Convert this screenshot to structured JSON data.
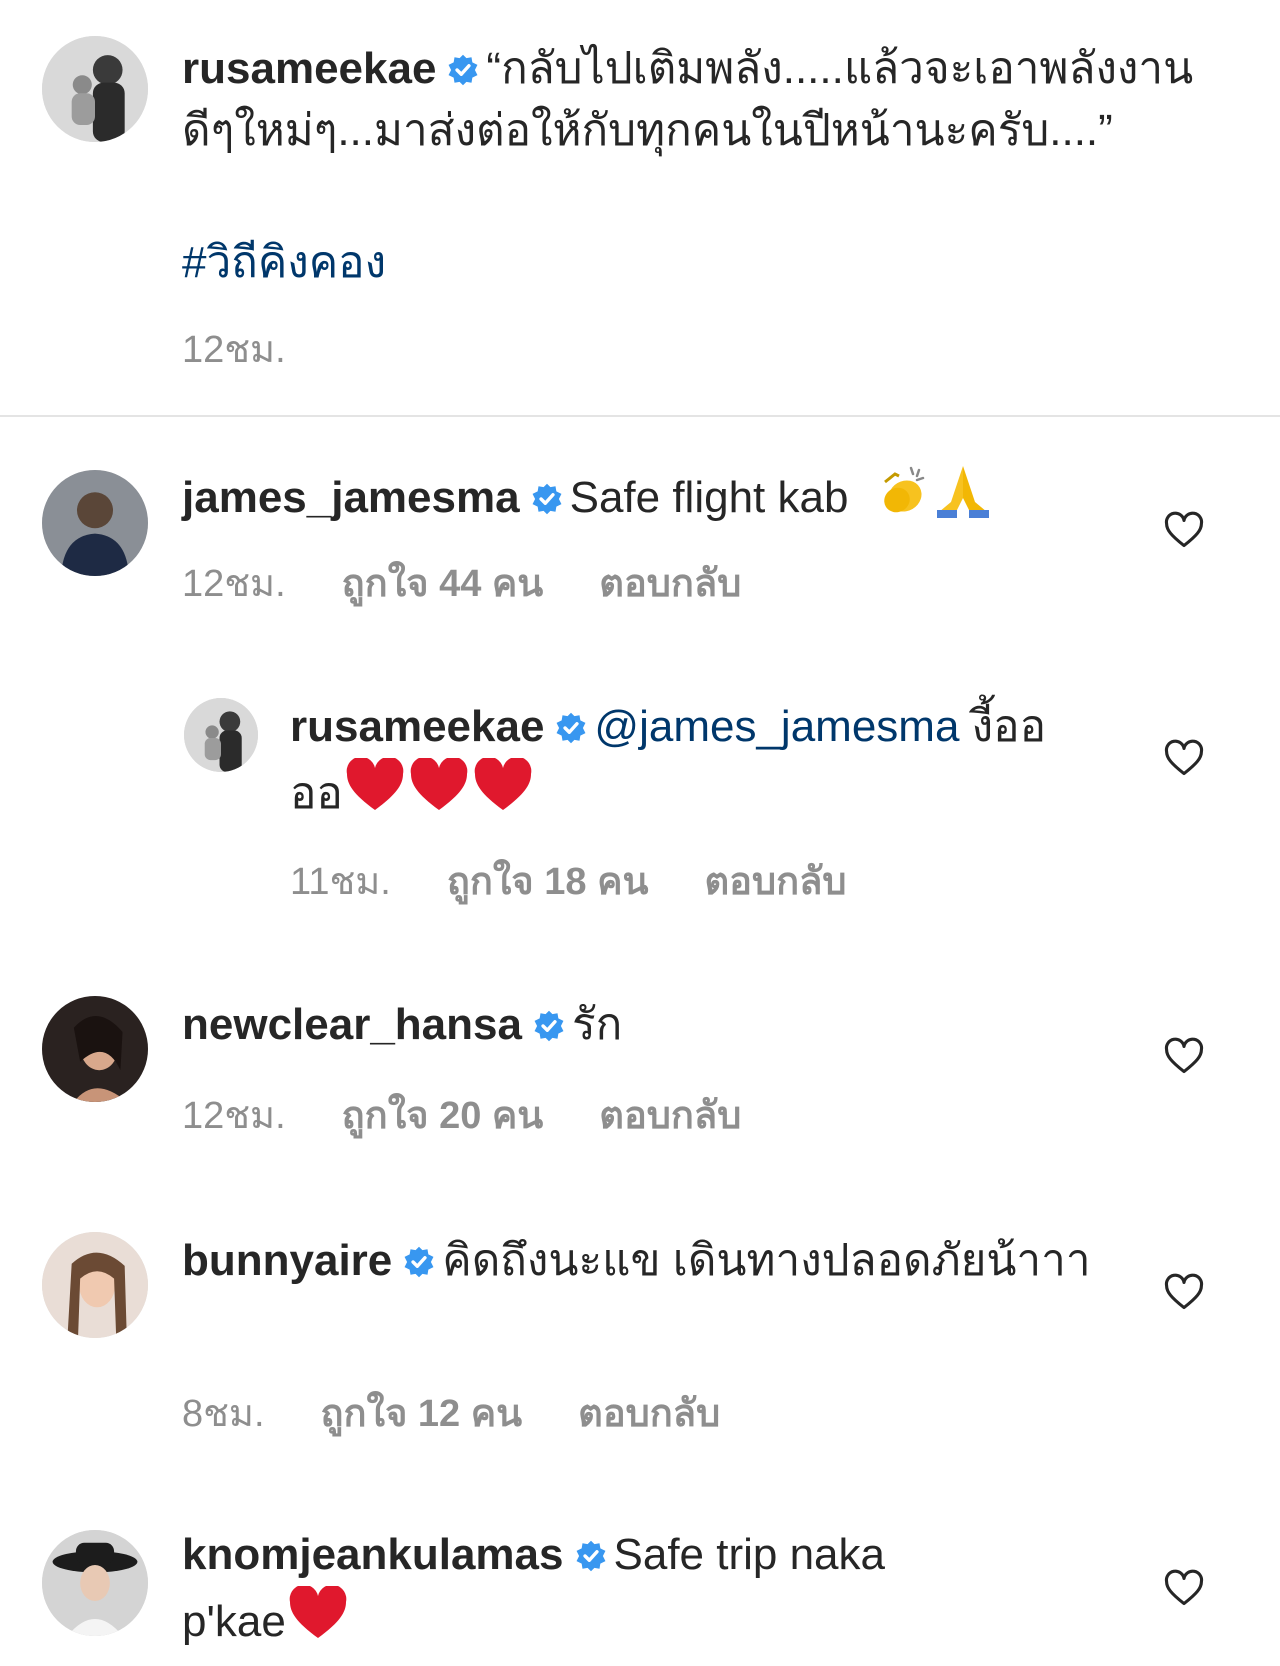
{
  "caption": {
    "username": "rusameekae",
    "text": "“กลับไปเติมพลัง.....แล้วจะเอาพลังงานดีๆใหม่ๆ...มาส่งต่อให้กับทุกคนในปีหน้านะครับ....”",
    "hashtag": "#วิถีคิงคอง",
    "time": "12ชม."
  },
  "comments": [
    {
      "username": "james_jamesma",
      "text": "Safe flight kab",
      "emojis": [
        "clapping-hands",
        "folded-hands"
      ],
      "time": "12ชม.",
      "likes": "ถูกใจ 44 คน",
      "reply": "ตอบกลับ"
    },
    {
      "username": "rusameekae",
      "mention": "@james_jamesma",
      "text": "งี้ออออ",
      "emojis": [
        "red-heart",
        "red-heart",
        "red-heart"
      ],
      "time": "11ชม.",
      "likes": "ถูกใจ 18 คน",
      "reply": "ตอบกลับ"
    },
    {
      "username": "newclear_hansa",
      "text": "รัก",
      "time": "12ชม.",
      "likes": "ถูกใจ 20 คน",
      "reply": "ตอบกลับ"
    },
    {
      "username": "bunnyaire",
      "text": "คิดถึงนะแข เดินทางปลอดภัยน้าาา",
      "time": "8ชม.",
      "likes": "ถูกใจ 12 คน",
      "reply": "ตอบกลับ"
    },
    {
      "username": "knomjeankulamas",
      "text": "Safe trip naka p'kae",
      "emojis": [
        "red-heart"
      ]
    }
  ],
  "colors": {
    "text": "#262626",
    "meta": "#8e8e8e",
    "link": "#00376b",
    "verified": "#3897f0",
    "heart_emoji": "#e0182d"
  }
}
